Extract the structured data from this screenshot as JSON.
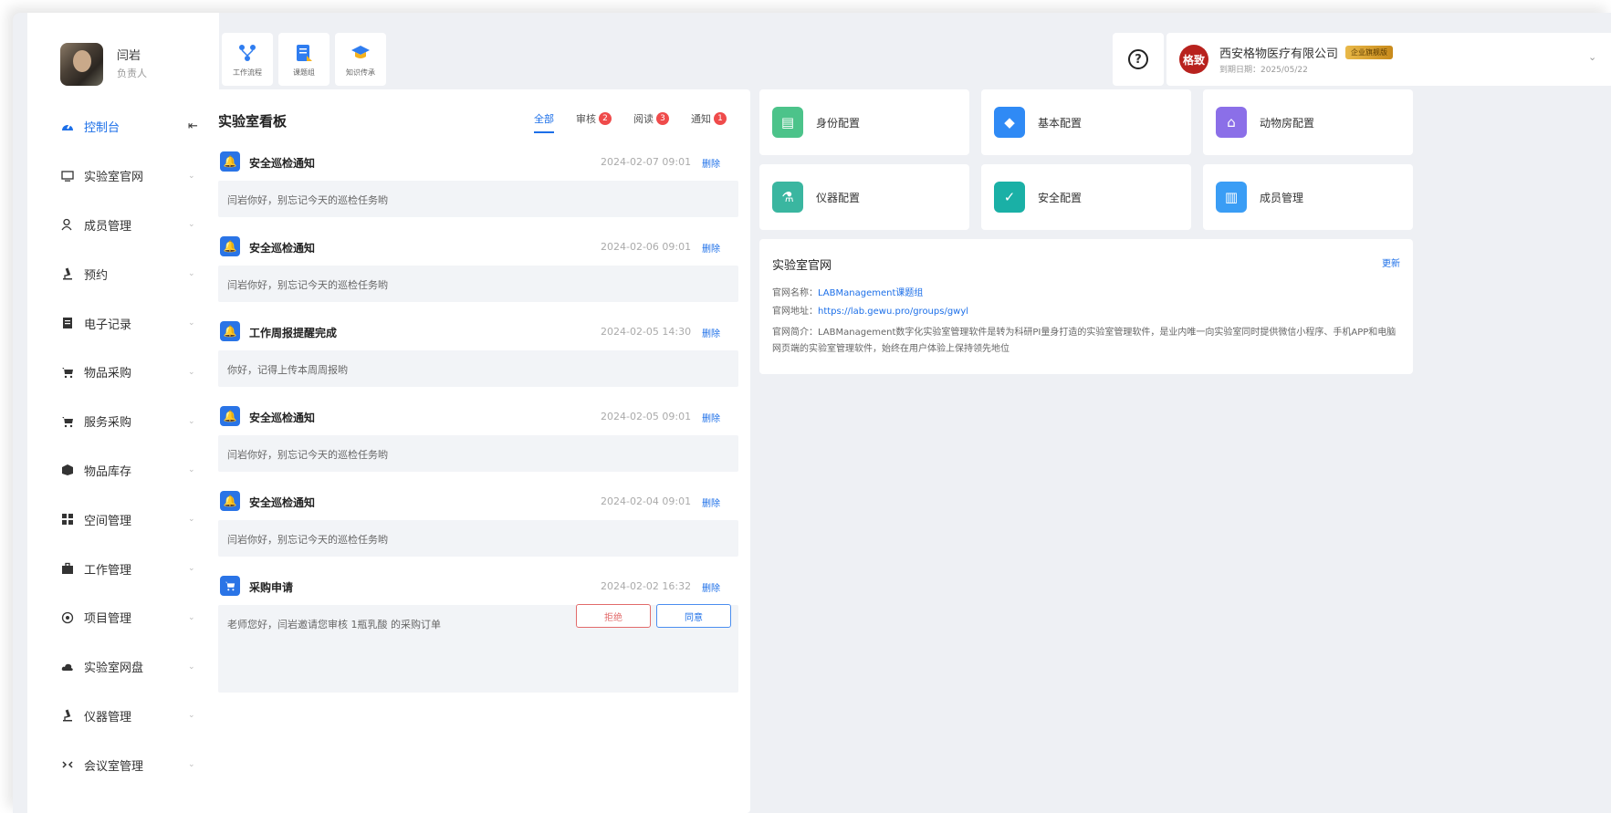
{
  "user": {
    "name": "闫岩",
    "role": "负责人"
  },
  "sidebar": {
    "collapse_icon": "collapse-left-icon",
    "items": [
      {
        "label": "控制台",
        "icon": "dashboard-icon",
        "active": true
      },
      {
        "label": "实验室官网",
        "icon": "monitor-icon"
      },
      {
        "label": "成员管理",
        "icon": "user-icon"
      },
      {
        "label": "预约",
        "icon": "microscope-icon"
      },
      {
        "label": "电子记录",
        "icon": "document-icon"
      },
      {
        "label": "物品采购",
        "icon": "cart-icon"
      },
      {
        "label": "服务采购",
        "icon": "cart-icon"
      },
      {
        "label": "物品库存",
        "icon": "box-icon"
      },
      {
        "label": "空间管理",
        "icon": "grid-icon"
      },
      {
        "label": "工作管理",
        "icon": "briefcase-icon"
      },
      {
        "label": "项目管理",
        "icon": "project-icon"
      },
      {
        "label": "实验室网盘",
        "icon": "cloud-icon"
      },
      {
        "label": "仪器管理",
        "icon": "microscope-icon"
      },
      {
        "label": "会议室管理",
        "icon": "meeting-icon"
      }
    ]
  },
  "toolbar": {
    "items": [
      {
        "label": "工作流程",
        "icon": "workflow-icon"
      },
      {
        "label": "课题组",
        "icon": "group-doc-icon"
      },
      {
        "label": "知识传承",
        "icon": "graduation-cap-icon"
      }
    ]
  },
  "org": {
    "logo_text": "格致",
    "name": "西安格物医疗有限公司",
    "badge": "企业旗舰版",
    "expiry": "到期日期：2025/05/22"
  },
  "board": {
    "title": "实验室看板",
    "tabs": [
      {
        "label": "全部",
        "active": true,
        "count": ""
      },
      {
        "label": "审核",
        "count": "2"
      },
      {
        "label": "阅读",
        "count": "3"
      },
      {
        "label": "通知",
        "count": "1"
      }
    ],
    "messages": [
      {
        "title": "安全巡检通知",
        "date": "2024-02-07 09:01",
        "action": "删除",
        "body": "闫岩你好，别忘记今天的巡检任务哟",
        "icon": "bell-icon"
      },
      {
        "title": "安全巡检通知",
        "date": "2024-02-06 09:01",
        "action": "删除",
        "body": "闫岩你好，别忘记今天的巡检任务哟",
        "icon": "bell-icon"
      },
      {
        "title": "工作周报提醒完成",
        "date": "2024-02-05 14:30",
        "action": "删除",
        "body": "你好，记得上传本周周报哟",
        "icon": "bell-icon"
      },
      {
        "title": "安全巡检通知",
        "date": "2024-02-05 09:01",
        "action": "删除",
        "body": "闫岩你好，别忘记今天的巡检任务哟",
        "icon": "bell-icon"
      },
      {
        "title": "安全巡检通知",
        "date": "2024-02-04 09:01",
        "action": "删除",
        "body": "闫岩你好，别忘记今天的巡检任务哟",
        "icon": "bell-icon"
      },
      {
        "title": "采购申请",
        "date": "2024-02-02 16:32",
        "action": "删除",
        "body": "老师您好，闫岩邀请您审核 1瓶乳酸 的采购订单",
        "icon": "cart-icon"
      }
    ],
    "reject_label": "拒绝",
    "agree_label": "同意"
  },
  "config_cards": [
    {
      "label": "身份配置",
      "icon": "id-card-icon",
      "color": "#4cc38a"
    },
    {
      "label": "基本配置",
      "icon": "layers-icon",
      "color": "#2f8af5"
    },
    {
      "label": "动物房配置",
      "icon": "house-icon",
      "color": "#8b6fe8"
    },
    {
      "label": "仪器配置",
      "icon": "microscope-icon",
      "color": "#3ab6a0"
    },
    {
      "label": "安全配置",
      "icon": "shield-icon",
      "color": "#1ab0a6"
    },
    {
      "label": "成员管理",
      "icon": "chart-image-icon",
      "color": "#3a9df5"
    }
  ],
  "site": {
    "title": "实验室官网",
    "update": "更新",
    "name_label": "官网名称：",
    "name_value": "LABManagement课题组",
    "url_label": "官网地址：",
    "url_value": "https://lab.gewu.pro/groups/gwyl",
    "intro_label": "官网简介：",
    "intro_value": "LABManagement数字化实验室管理软件是转为科研PI量身打造的实验室管理软件，是业内唯一向实验室同时提供微信小程序、手机APP和电脑网页端的实验室管理软件，始终在用户体验上保持领先地位"
  }
}
